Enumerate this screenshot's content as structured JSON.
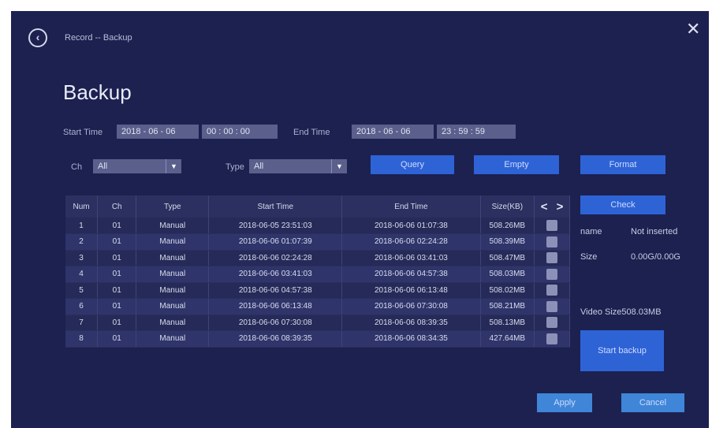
{
  "header": {
    "back_icon": "chevron-left-circle-icon",
    "breadcrumb": "Record -- Backup",
    "close_symbol": "✕",
    "title": "Backup"
  },
  "filters": {
    "start_time_label": "Start Time",
    "start_date": "2018 - 06 - 06",
    "start_time": "00 : 00 : 00",
    "end_time_label": "End Time",
    "end_date": "2018 - 06 - 06",
    "end_time": "23 : 59 : 59",
    "ch_label": "Ch",
    "ch_value": "All",
    "type_label": "Type",
    "type_value": "All"
  },
  "buttons": {
    "query": "Query",
    "empty": "Empty",
    "format": "Format",
    "check": "Check",
    "start_backup": "Start backup",
    "apply": "Apply",
    "cancel": "Cancel"
  },
  "table": {
    "headers": [
      "Num",
      "Ch",
      "Type",
      "Start Time",
      "End Time",
      "Size(KB)"
    ],
    "rows": [
      [
        "1",
        "01",
        "Manual",
        "2018-06-05 23:51:03",
        "2018-06-06 01:07:38",
        "508.26MB"
      ],
      [
        "2",
        "01",
        "Manual",
        "2018-06-06 01:07:39",
        "2018-06-06 02:24:28",
        "508.39MB"
      ],
      [
        "3",
        "01",
        "Manual",
        "2018-06-06 02:24:28",
        "2018-06-06 03:41:03",
        "508.47MB"
      ],
      [
        "4",
        "01",
        "Manual",
        "2018-06-06 03:41:03",
        "2018-06-06 04:57:38",
        "508.03MB"
      ],
      [
        "5",
        "01",
        "Manual",
        "2018-06-06 04:57:38",
        "2018-06-06 06:13:48",
        "508.02MB"
      ],
      [
        "6",
        "01",
        "Manual",
        "2018-06-06 06:13:48",
        "2018-06-06 07:30:08",
        "508.21MB"
      ],
      [
        "7",
        "01",
        "Manual",
        "2018-06-06 07:30:08",
        "2018-06-06 08:39:35",
        "508.13MB"
      ],
      [
        "8",
        "01",
        "Manual",
        "2018-06-06 08:39:35",
        "2018-06-06 08:34:35",
        "427.64MB"
      ]
    ]
  },
  "storage": {
    "name_label": "name",
    "name_value": "Not inserted",
    "size_label": "Size",
    "size_value": "0.00G/0.00G",
    "video_size": "Video Size508.03MB"
  },
  "colors": {
    "background": "#1c2150",
    "button": "#2e63d6",
    "button_light": "#3f86d8",
    "field": "#5a5f8c"
  }
}
